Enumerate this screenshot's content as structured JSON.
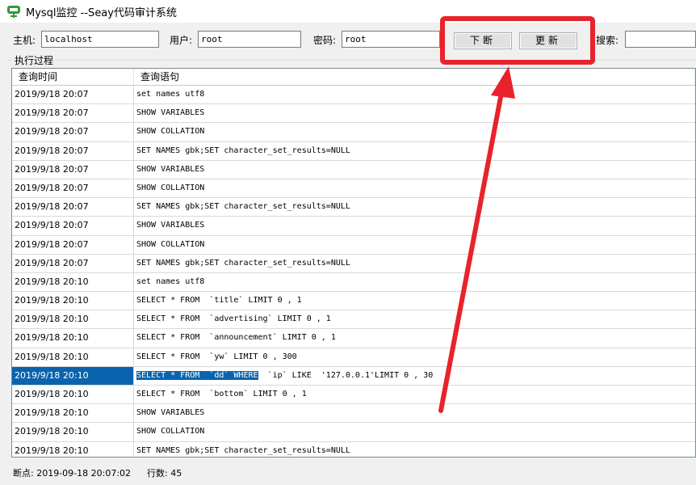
{
  "window": {
    "title": "Mysql监控 --Seay代码审计系统"
  },
  "toolbar": {
    "host_label": "主机:",
    "host_value": "localhost",
    "user_label": "用户:",
    "user_value": "root",
    "password_label": "密码:",
    "password_value": "root",
    "break_button": "下断",
    "update_button": "更新",
    "search_label": "搜索:",
    "search_value": ""
  },
  "group": {
    "label": "执行过程"
  },
  "grid": {
    "columns": [
      "查询时间",
      "查询语句"
    ],
    "rows": [
      {
        "time": "2019/9/18 20:07",
        "query": "set names utf8"
      },
      {
        "time": "2019/9/18 20:07",
        "query": "SHOW VARIABLES"
      },
      {
        "time": "2019/9/18 20:07",
        "query": "SHOW COLLATION"
      },
      {
        "time": "2019/9/18 20:07",
        "query": "SET NAMES gbk;SET character_set_results=NULL"
      },
      {
        "time": "2019/9/18 20:07",
        "query": "SHOW VARIABLES"
      },
      {
        "time": "2019/9/18 20:07",
        "query": "SHOW COLLATION"
      },
      {
        "time": "2019/9/18 20:07",
        "query": "SET NAMES gbk;SET character_set_results=NULL"
      },
      {
        "time": "2019/9/18 20:07",
        "query": "SHOW VARIABLES"
      },
      {
        "time": "2019/9/18 20:07",
        "query": "SHOW COLLATION"
      },
      {
        "time": "2019/9/18 20:07",
        "query": "SET NAMES gbk;SET character_set_results=NULL"
      },
      {
        "time": "2019/9/18 20:10",
        "query": "set names utf8"
      },
      {
        "time": "2019/9/18 20:10",
        "query": "SELECT * FROM  `title` LIMIT 0 , 1"
      },
      {
        "time": "2019/9/18 20:10",
        "query": "SELECT * FROM  `advertising` LIMIT 0 , 1"
      },
      {
        "time": "2019/9/18 20:10",
        "query": "SELECT * FROM  `announcement` LIMIT 0 , 1"
      },
      {
        "time": "2019/9/18 20:10",
        "query": "SELECT * FROM  `yw` LIMIT 0 , 300"
      },
      {
        "time": "2019/9/18 20:10",
        "query_selected": "SELECT * FROM  `dd` WHERE",
        "query_rest": "  `ip` LIKE  '127.0.0.1'LIMIT 0 , 30",
        "selected": true
      },
      {
        "time": "2019/9/18 20:10",
        "query": "SELECT * FROM  `bottom` LIMIT 0 , 1"
      },
      {
        "time": "2019/9/18 20:10",
        "query": "SHOW VARIABLES"
      },
      {
        "time": "2019/9/18 20:10",
        "query": "SHOW COLLATION"
      },
      {
        "time": "2019/9/18 20:10",
        "query": "SET NAMES gbk;SET character_set_results=NULL"
      }
    ]
  },
  "status": {
    "breakpoint": "断点: 2019-09-18 20:07:02",
    "row_count": "行数: 45"
  },
  "annotation": {
    "color": "#e8232b"
  },
  "icons": {
    "app": "app-logo-icon",
    "arrow": "annotation-arrow"
  }
}
